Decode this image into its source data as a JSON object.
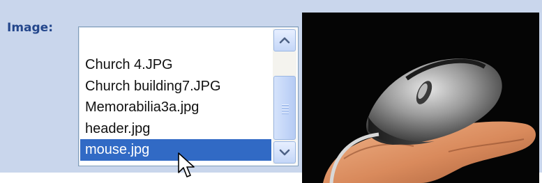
{
  "form": {
    "image_label": "Image:"
  },
  "image_list": {
    "items": [
      "Church 4.JPG",
      "Church building7.JPG",
      "Memorabilia3a.jpg",
      "header.jpg",
      "mouse.jpg"
    ],
    "selected": "mouse.jpg"
  },
  "preview": {
    "subject": "computer mouse held in hand"
  },
  "colors": {
    "panel_bg": "#c9d6ec",
    "label": "#24478c",
    "selection": "#316ac5",
    "scrollbar_arrow": "#4d6185"
  },
  "icons": {
    "scroll_up": "chevron-up-icon",
    "scroll_down": "chevron-down-icon",
    "pointer": "mouse-pointer-icon"
  }
}
